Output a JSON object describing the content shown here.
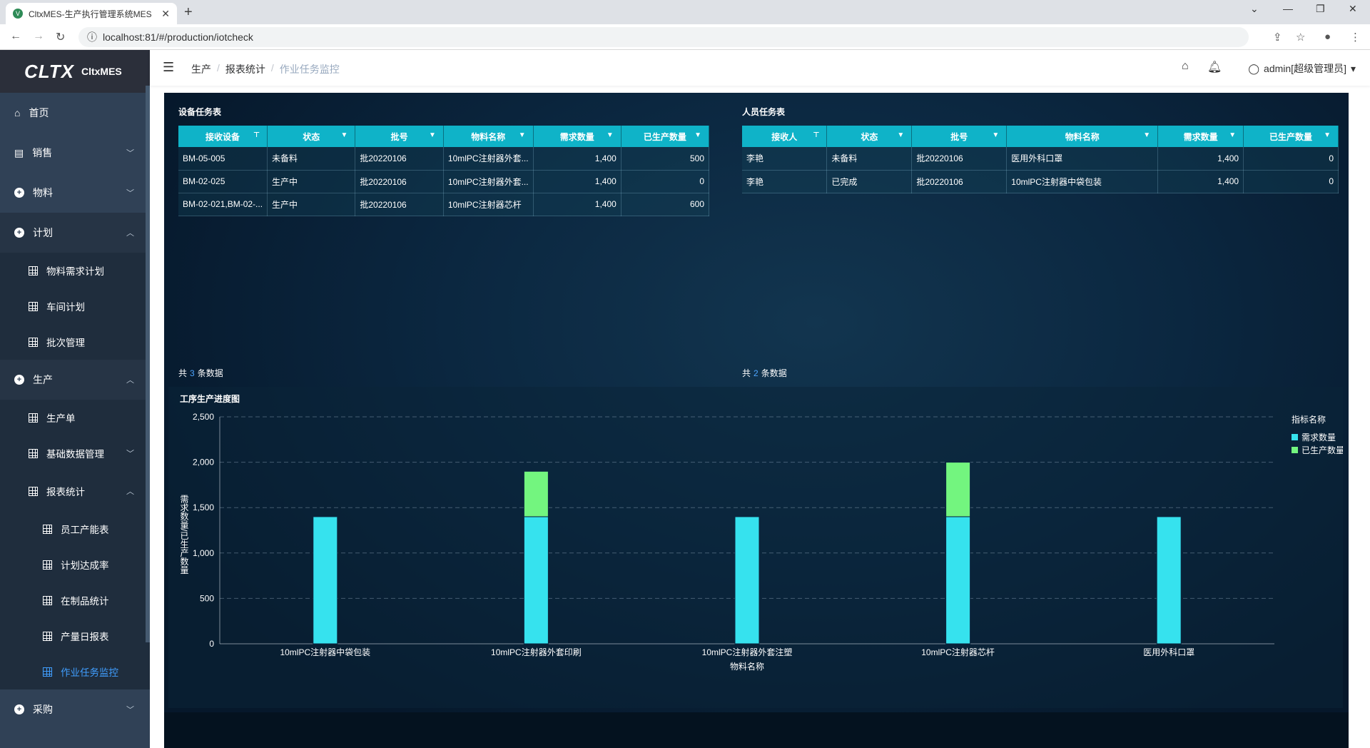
{
  "browser": {
    "tab_title": "CltxMES-生产执行管理系统MES",
    "url": "localhost:81/#/production/iotcheck"
  },
  "sidebar": {
    "logo_mark": "CLTX",
    "logo_name": "CltxMES",
    "items": [
      {
        "label": "首页",
        "icon": "home-icon"
      },
      {
        "label": "销售",
        "icon": "document-icon"
      },
      {
        "label": "物料",
        "icon": "plus-circle-icon"
      },
      {
        "label": "计划",
        "icon": "plus-circle-icon"
      },
      {
        "label": "物料需求计划",
        "icon": "grid-icon"
      },
      {
        "label": "车间计划",
        "icon": "grid-icon"
      },
      {
        "label": "批次管理",
        "icon": "grid-icon"
      },
      {
        "label": "生产",
        "icon": "plus-circle-icon"
      },
      {
        "label": "生产单",
        "icon": "grid-icon"
      },
      {
        "label": "基础数据管理",
        "icon": "grid-icon"
      },
      {
        "label": "报表统计",
        "icon": "grid-icon"
      },
      {
        "label": "员工产能表",
        "icon": "grid-icon"
      },
      {
        "label": "计划达成率",
        "icon": "grid-icon"
      },
      {
        "label": "在制品统计",
        "icon": "grid-icon"
      },
      {
        "label": "产量日报表",
        "icon": "grid-icon"
      },
      {
        "label": "作业任务监控",
        "icon": "grid-icon"
      },
      {
        "label": "采购",
        "icon": "plus-circle-icon"
      }
    ]
  },
  "header": {
    "breadcrumb": [
      "生产",
      "报表统计",
      "作业任务监控"
    ],
    "user": "admin[超级管理员]"
  },
  "device_table": {
    "title": "设备任务表",
    "columns": [
      "接收设备",
      "状态",
      "批号",
      "物料名称",
      "需求数量",
      "已生产数量"
    ],
    "rows": [
      [
        "BM-05-005",
        "未备料",
        "批20220106",
        "10mlPC注射器外套...",
        "1,400",
        "500"
      ],
      [
        "BM-02-025",
        "生产中",
        "批20220106",
        "10mlPC注射器外套...",
        "1,400",
        "0"
      ],
      [
        "BM-02-021,BM-02-...",
        "生产中",
        "批20220106",
        "10mlPC注射器芯杆",
        "1,400",
        "600"
      ]
    ],
    "footer_prefix": "共",
    "footer_count": "3",
    "footer_suffix": "条数据"
  },
  "person_table": {
    "title": "人员任务表",
    "columns": [
      "接收人",
      "状态",
      "批号",
      "物料名称",
      "需求数量",
      "已生产数量"
    ],
    "rows": [
      [
        "李艳",
        "未备料",
        "批20220106",
        "医用外科口罩",
        "1,400",
        "0"
      ],
      [
        "李艳",
        "已完成",
        "批20220106",
        "10mlPC注射器中袋包装",
        "1,400",
        "0"
      ]
    ],
    "footer_prefix": "共",
    "footer_count": "2",
    "footer_suffix": "条数据"
  },
  "chart_data": {
    "type": "bar",
    "title": "工序生产进度图",
    "xlabel": "物料名称",
    "ylabel": "需求数量/已生产数量",
    "legend_title": "指标名称",
    "categories": [
      "10mlPC注射器中袋包装",
      "10mlPC注射器外套印刷",
      "10mlPC注射器外套注塑",
      "10mlPC注射器芯杆",
      "医用外科口罩"
    ],
    "series": [
      {
        "name": "需求数量",
        "color": "#36e2ee",
        "values": [
          1400,
          1400,
          1400,
          1400,
          1400
        ]
      },
      {
        "name": "已生产数量",
        "color": "#73f57f",
        "values": [
          0,
          500,
          0,
          600,
          0
        ]
      }
    ],
    "stacked": true,
    "ylim": [
      0,
      2500
    ],
    "yticks": [
      "0",
      "500",
      "1,000",
      "1,500",
      "2,000",
      "2,500"
    ],
    "grid": true,
    "legend_position": "top-right"
  }
}
